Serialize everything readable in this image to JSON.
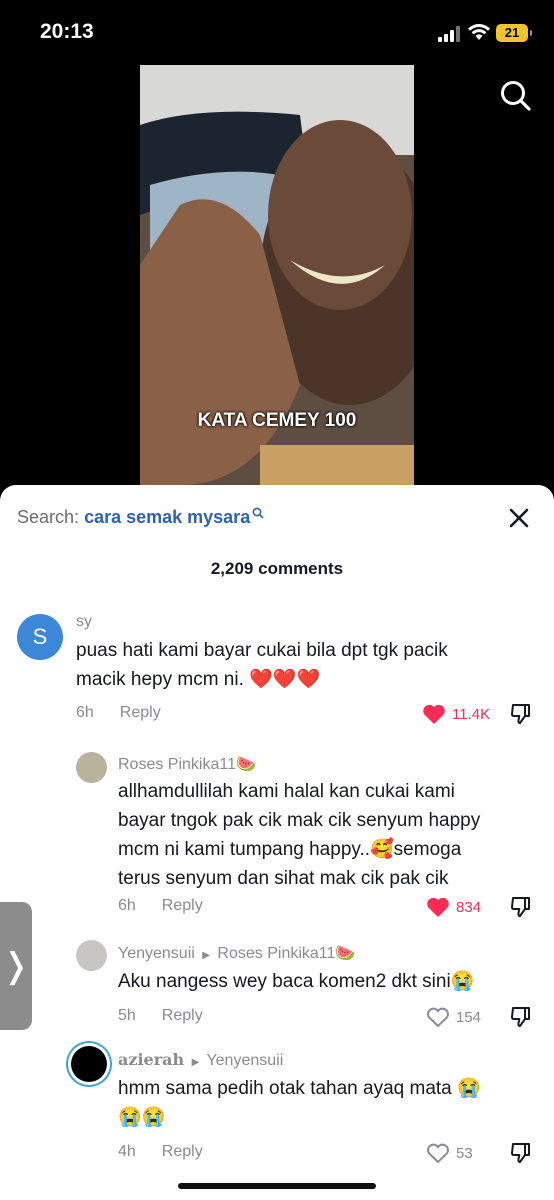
{
  "status_bar": {
    "time": "20:13",
    "battery": "21"
  },
  "video": {
    "caption": "KATA CEMEY 100"
  },
  "sheet": {
    "search_label": "Search:",
    "search_query": "cara semak mysara",
    "comment_count": "2,209 comments"
  },
  "comments": [
    {
      "avatar_letter": "S",
      "username": "sy",
      "text_line1": "puas hati kami bayar cukai bila dpt tgk pacik",
      "text_line2": "macik hepy mcm ni. ❤️❤️❤️",
      "time": "6h",
      "reply": "Reply",
      "likes": "11.4K",
      "liked": true
    },
    {
      "username": "Roses Pinkika11🍉",
      "text_line1": "allhamdullilah kami halal kan cukai kami",
      "text_line2": "bayar tngok pak cik mak cik senyum happy",
      "text_line3": "mcm ni kami tumpang happy..🥰semoga",
      "text_line4": "terus senyum dan sihat mak cik pak cik",
      "time": "6h",
      "reply": "Reply",
      "likes": "834",
      "liked": true
    },
    {
      "username": "Yenyensuii",
      "reply_to": "Roses Pinkika11🍉",
      "text_line1": "Aku nangess wey baca komen2 dkt sini😭",
      "time": "5h",
      "reply": "Reply",
      "likes": "154",
      "liked": false
    },
    {
      "username": "azierah",
      "reply_to": "Yenyensuii",
      "text_line1": "hmm sama pedih otak tahan ayaq mata 😭",
      "text_line2": "😭😭",
      "time": "4h",
      "reply": "Reply",
      "likes": "53",
      "liked": false
    }
  ],
  "colors": {
    "accent_red": "#fe2c55",
    "link_blue": "#2e62b5",
    "battery_yellow": "#f4c430"
  },
  "icons": [
    "signal-icon",
    "wifi-icon",
    "search-icon",
    "close-icon",
    "heart-icon",
    "dislike-icon",
    "chevron-right-icon"
  ]
}
